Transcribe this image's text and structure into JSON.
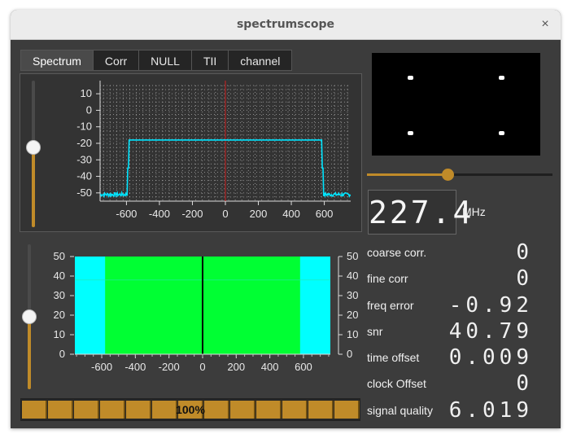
{
  "window": {
    "title": "spectrumscope",
    "close_glyph": "×"
  },
  "tabs": [
    {
      "label": "Spectrum",
      "active": true
    },
    {
      "label": "Corr",
      "active": false
    },
    {
      "label": "NULL",
      "active": false
    },
    {
      "label": "TII",
      "active": false
    },
    {
      "label": "channel",
      "active": false
    }
  ],
  "spectrum_slider": {
    "value_fraction": 0.55
  },
  "waterfall_slider": {
    "value_fraction": 0.5
  },
  "constellation_slider": {
    "value_fraction": 0.43
  },
  "frequency": {
    "value": "227.4",
    "unit": "MHz"
  },
  "stats": [
    {
      "label": "coarse corr.",
      "value": "0"
    },
    {
      "label": "fine corr",
      "value": "0"
    },
    {
      "label": "freq error",
      "value": "-0.92"
    },
    {
      "label": "snr",
      "value": "40.79"
    },
    {
      "label": "time offset",
      "value": "0.009"
    },
    {
      "label": "clock Offset",
      "value": "0"
    },
    {
      "label": "signal quality",
      "value": "6.019"
    }
  ],
  "quality_bar": {
    "text": "100%",
    "percent": 100
  },
  "colors": {
    "accent": "#c08b29",
    "spectrum_line": "#00e5ff",
    "center_line": "#d02020",
    "waterfall_signal": "#00ff33",
    "waterfall_noise": "#00ffff"
  },
  "chart_data": [
    {
      "type": "line",
      "title": "",
      "xlabel": "",
      "ylabel": "",
      "xlim": [
        -760,
        760
      ],
      "ylim": [
        -55,
        15
      ],
      "x_ticks": [
        "-600",
        "-400",
        "-200",
        "0",
        "200",
        "400",
        "600"
      ],
      "y_ticks": [
        "10",
        "0",
        "-10",
        "-20",
        "-30",
        "-40",
        "-50"
      ],
      "grid": true,
      "series": [
        {
          "x": [
            -770,
            -600,
            -590,
            -580,
            580,
            590,
            600,
            770
          ],
          "y": [
            -51,
            -51,
            -51,
            -18,
            -18,
            -51,
            -51,
            -51
          ]
        }
      ],
      "center_marker_x": 0
    },
    {
      "type": "heatmap",
      "title": "",
      "xlim": [
        -760,
        760
      ],
      "ylim": [
        0,
        50
      ],
      "x_ticks": [
        "-600",
        "-400",
        "-200",
        "0",
        "200",
        "400",
        "600"
      ],
      "y_ticks_left": [
        "50",
        "40",
        "30",
        "20",
        "10",
        "0"
      ],
      "y_ticks_right": [
        "50",
        "40",
        "30",
        "20",
        "10",
        "0"
      ],
      "signal_band": [
        -580,
        580
      ],
      "center_marker_x": 0
    }
  ]
}
